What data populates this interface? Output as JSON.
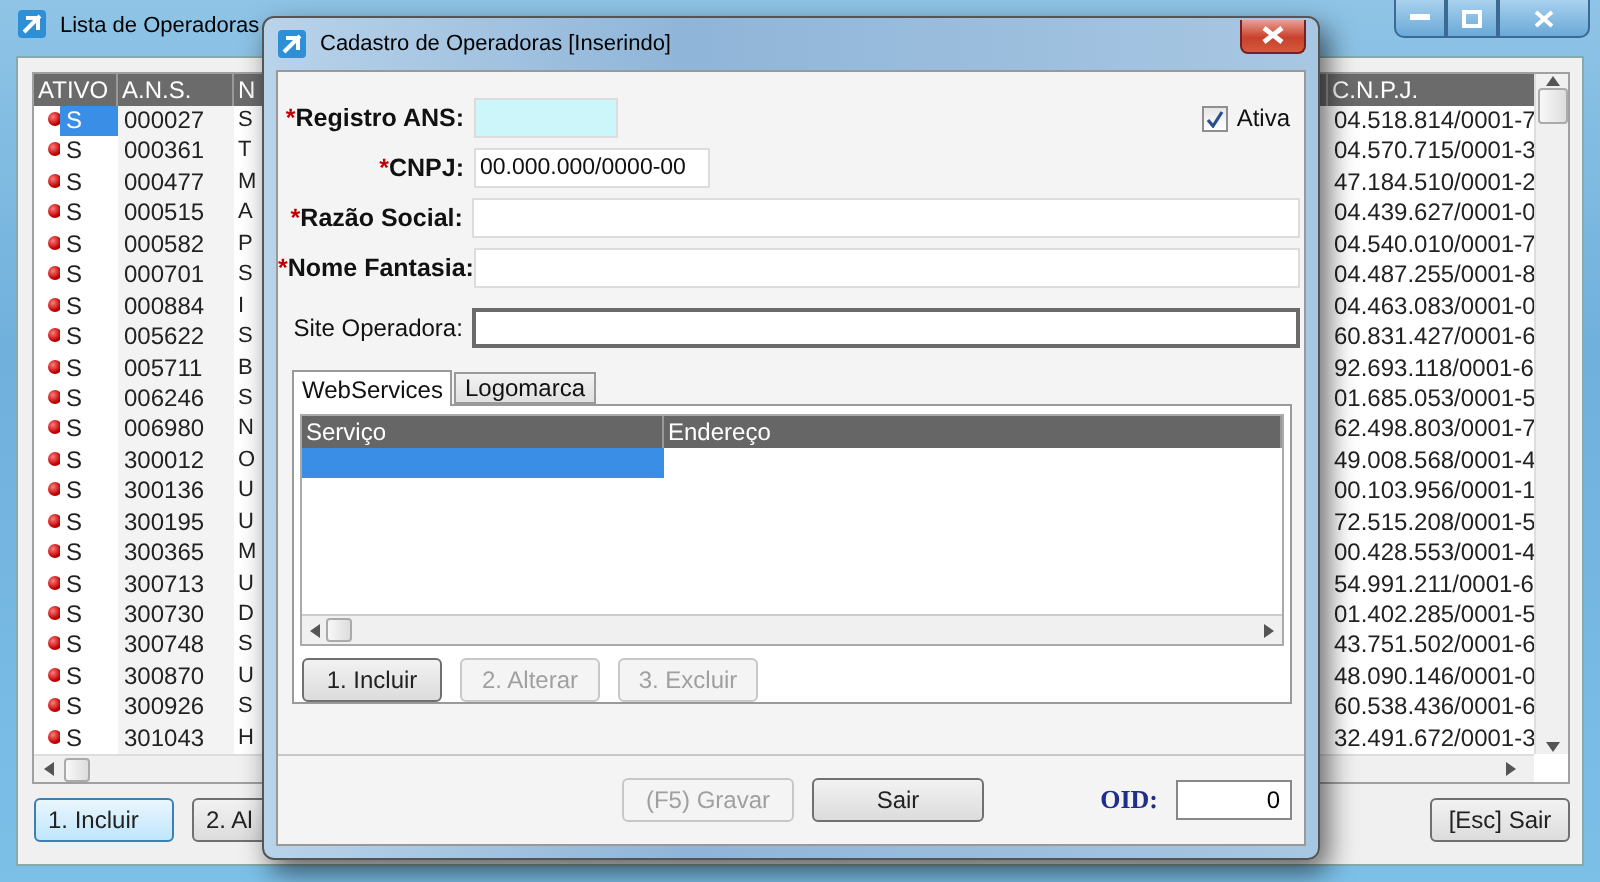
{
  "main_window": {
    "title": "Lista de Operadoras",
    "table": {
      "columns": [
        "ATIVO",
        "A.N.S.",
        "N",
        "C.N.P.J."
      ],
      "rows": [
        {
          "ativo": "S",
          "ans": "000027",
          "column_3": "S",
          "cnpj": "04.518.814/0001-7",
          "selected": true
        },
        {
          "ativo": "S",
          "ans": "000361",
          "column_3": "T",
          "cnpj": "04.570.715/0001-3",
          "selected": false
        },
        {
          "ativo": "S",
          "ans": "000477",
          "column_3": "M",
          "cnpj": "47.184.510/0001-2",
          "selected": false
        },
        {
          "ativo": "S",
          "ans": "000515",
          "column_3": "A",
          "cnpj": "04.439.627/0001-0",
          "selected": false
        },
        {
          "ativo": "S",
          "ans": "000582",
          "column_3": "P",
          "cnpj": "04.540.010/0001-7",
          "selected": false
        },
        {
          "ativo": "S",
          "ans": "000701",
          "column_3": "S",
          "cnpj": "04.487.255/0001-8",
          "selected": false
        },
        {
          "ativo": "S",
          "ans": "000884",
          "column_3": "I",
          "cnpj": "04.463.083/0001-0",
          "selected": false
        },
        {
          "ativo": "S",
          "ans": "005622",
          "column_3": "S",
          "cnpj": "60.831.427/0001-6",
          "selected": false
        },
        {
          "ativo": "S",
          "ans": "005711",
          "column_3": "B",
          "cnpj": "92.693.118/0001-6",
          "selected": false
        },
        {
          "ativo": "S",
          "ans": "006246",
          "column_3": "S",
          "cnpj": "01.685.053/0001-5",
          "selected": false
        },
        {
          "ativo": "S",
          "ans": "006980",
          "column_3": "N",
          "cnpj": "62.498.803/0001-7",
          "selected": false
        },
        {
          "ativo": "S",
          "ans": "300012",
          "column_3": "O",
          "cnpj": "49.008.568/0001-4",
          "selected": false
        },
        {
          "ativo": "S",
          "ans": "300136",
          "column_3": "U",
          "cnpj": "00.103.956/0001-1",
          "selected": false
        },
        {
          "ativo": "S",
          "ans": "300195",
          "column_3": "U",
          "cnpj": "72.515.208/0001-5",
          "selected": false
        },
        {
          "ativo": "S",
          "ans": "300365",
          "column_3": "M",
          "cnpj": "00.428.553/0001-4",
          "selected": false
        },
        {
          "ativo": "S",
          "ans": "300713",
          "column_3": "U",
          "cnpj": "54.991.211/0001-6",
          "selected": false
        },
        {
          "ativo": "S",
          "ans": "300730",
          "column_3": "D",
          "cnpj": "01.402.285/0001-5",
          "selected": false
        },
        {
          "ativo": "S",
          "ans": "300748",
          "column_3": "S",
          "cnpj": "43.751.502/0001-6",
          "selected": false
        },
        {
          "ativo": "S",
          "ans": "300870",
          "column_3": "U",
          "cnpj": "48.090.146/0001-0",
          "selected": false
        },
        {
          "ativo": "S",
          "ans": "300926",
          "column_3": "S",
          "cnpj": "60.538.436/0001-6",
          "selected": false
        },
        {
          "ativo": "S",
          "ans": "301043",
          "column_3": "H",
          "cnpj": "32.491.672/0001-3",
          "selected": false
        }
      ]
    },
    "buttons": [
      {
        "label": "1. Incluir",
        "focused": true
      },
      {
        "label": "2. Al",
        "focused": false
      }
    ],
    "exit_button": "[Esc] Sair"
  },
  "dialog": {
    "title": "Cadastro de Operadoras [Inserindo]",
    "fields": [
      {
        "label": "Registro ANS:",
        "required": true,
        "marker": "*",
        "focused": true
      },
      {
        "label": "CNPJ:",
        "required": true,
        "marker": "*",
        "focused": false,
        "value": "00.000.000/0000-00"
      },
      {
        "label": "Razão Social:",
        "required": true,
        "marker": "*",
        "focused": false
      },
      {
        "label": "Nome Fantasia:",
        "required": true,
        "marker": "*",
        "focused": false
      },
      {
        "label": "Site Operadora:",
        "required": false,
        "focused": false
      }
    ],
    "active_checkbox": {
      "label": "Ativa",
      "checked": true
    },
    "tabs": [
      {
        "label": "WebServices",
        "selected": true
      },
      {
        "label": "Logomarca",
        "selected": false
      }
    ],
    "grid": {
      "columns": [
        "Serviço",
        "Endereço"
      ],
      "rows": [
        {
          "selected": true
        }
      ]
    },
    "grid_buttons": [
      {
        "label": "1. Incluir",
        "disabled": false
      },
      {
        "label": "2. Alterar",
        "disabled": true
      },
      {
        "label": "3. Excluir",
        "disabled": true
      }
    ],
    "footer_buttons": [
      {
        "label": "(F5) Gravar",
        "disabled": true
      },
      {
        "label": "Sair",
        "disabled": false
      }
    ],
    "oid": {
      "label": "OID:",
      "value": "0"
    }
  }
}
